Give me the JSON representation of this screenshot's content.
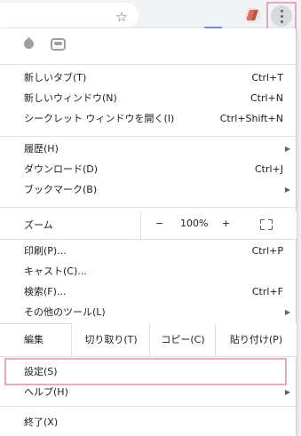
{
  "toolbar": {
    "star_icon": "star-icon",
    "menu_icon": "three-dots-vertical-icon"
  },
  "extensions": [
    "droplet-icon",
    "line-app-icon"
  ],
  "sections": [
    {
      "items": [
        {
          "label": "新しいタブ(T)",
          "shortcut": "Ctrl+T"
        },
        {
          "label": "新しいウィンドウ(N)",
          "shortcut": "Ctrl+N"
        },
        {
          "label": "シークレット ウィンドウを開く(I)",
          "shortcut": "Ctrl+Shift+N"
        }
      ]
    },
    {
      "items": [
        {
          "label": "履歴(H)",
          "shortcut": "",
          "submenu": true
        },
        {
          "label": "ダウンロード(D)",
          "shortcut": "Ctrl+J"
        },
        {
          "label": "ブックマーク(B)",
          "shortcut": "",
          "submenu": true
        }
      ]
    }
  ],
  "zoom": {
    "label": "ズーム",
    "minus": "−",
    "value": "100%",
    "plus": "+"
  },
  "tools": [
    {
      "label": "印刷(P)...",
      "shortcut": "Ctrl+P"
    },
    {
      "label": "キャスト(C)...",
      "shortcut": ""
    },
    {
      "label": "検索(F)...",
      "shortcut": "Ctrl+F"
    },
    {
      "label": "その他のツール(L)",
      "shortcut": "",
      "submenu": true
    }
  ],
  "edit": {
    "label": "編集",
    "cut": "切り取り(T)",
    "copy": "コピー(C)",
    "paste": "貼り付け(P)"
  },
  "settings": {
    "label": "設定(S)"
  },
  "help": {
    "label": "ヘルプ(H)",
    "submenu": true
  },
  "exit": {
    "label": "終了(X)"
  },
  "colors": {
    "highlight": "#e8a7c3",
    "menu_bg": "#ffffff",
    "toolbar_bg": "#f1f3f4"
  }
}
